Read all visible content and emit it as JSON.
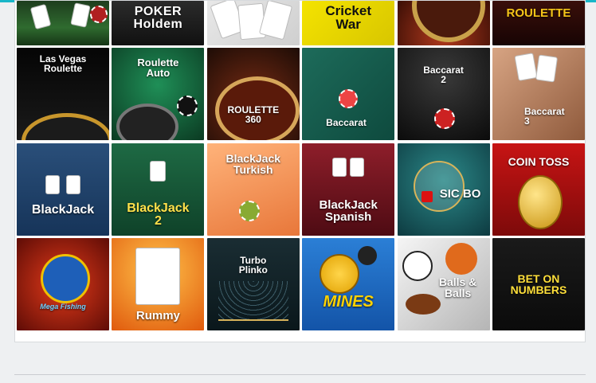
{
  "games": [
    {
      "title": "",
      "bg": "linear-gradient(180deg,#1e3d1e 0%,#2f6b2f 60%,#163516 100%)"
    },
    {
      "title": "POKER\nHoldem",
      "bg": "linear-gradient(180deg,#2b2b2b,#111)"
    },
    {
      "title": "",
      "bg": "linear-gradient(135deg,#e8e8e8,#cfcfcf)"
    },
    {
      "title": "Cricket\nWar",
      "bg": "linear-gradient(135deg,#f4e300,#d8c600)"
    },
    {
      "title": "",
      "bg": "radial-gradient(circle at 50% 80%,#b33a1e,#3a0e05)"
    },
    {
      "title": "ROULETTE",
      "bg": "linear-gradient(180deg,#3a0f0a,#170404)"
    },
    {
      "title": "Las Vegas\nRoulette",
      "bg": "linear-gradient(180deg,#050505,#1a1a1a)"
    },
    {
      "title": "Roulette\nAuto",
      "bg": "radial-gradient(circle at 50% 40%,#1f8f57,#0b3a22)"
    },
    {
      "title": "ROULETTE\n360",
      "bg": "radial-gradient(circle at 50% 60%,#7a2c14,#1d0c06)"
    },
    {
      "title": "Baccarat",
      "bg": "linear-gradient(135deg,#1d6b5a,#0e4a3e)"
    },
    {
      "title": "Baccarat\n2",
      "bg": "radial-gradient(circle at 50% 30%,#3a3a3a,#0b0b0b)"
    },
    {
      "title": "Baccarat\n3",
      "bg": "linear-gradient(135deg,#d7a483,#8f5a3c)"
    },
    {
      "title": "BlackJack",
      "bg": "linear-gradient(180deg,#2a4f7a,#163459)"
    },
    {
      "title": "BlackJack\n2",
      "bg": "linear-gradient(180deg,#1e6a44,#0f4229)"
    },
    {
      "title": "BlackJack\nTurkish",
      "bg": "linear-gradient(160deg,#ffb37a,#e8773a)"
    },
    {
      "title": "BlackJack\nSpanish",
      "bg": "linear-gradient(180deg,#8e1e2a,#4e0b13)"
    },
    {
      "title": "SIC BO",
      "bg": "radial-gradient(circle at 50% 40%,#2c8a8a,#0d3a40)"
    },
    {
      "title": "COIN TOSS",
      "bg": "linear-gradient(180deg,#c71414,#7d0a0a)"
    },
    {
      "title": "Mega Fishing",
      "bg": "radial-gradient(circle at 50% 50%,#e53b1a,#5e0c06)"
    },
    {
      "title": "Rummy",
      "bg": "radial-gradient(circle at 50% 35%,#ffc24a,#e05a0d)"
    },
    {
      "title": "Turbo\nPlinko",
      "bg": "linear-gradient(180deg,#1a2d33,#0a171b)"
    },
    {
      "title": "MINES",
      "bg": "linear-gradient(180deg,#2b7fd6,#1354a8)"
    },
    {
      "title": "Balls &\nBalls",
      "bg": "linear-gradient(135deg,#f5f5f5,#b5b5b5)"
    },
    {
      "title": "BET ON\nNUMBERS",
      "bg": "linear-gradient(180deg,#1a1a1a,#0b0b0b)"
    }
  ]
}
